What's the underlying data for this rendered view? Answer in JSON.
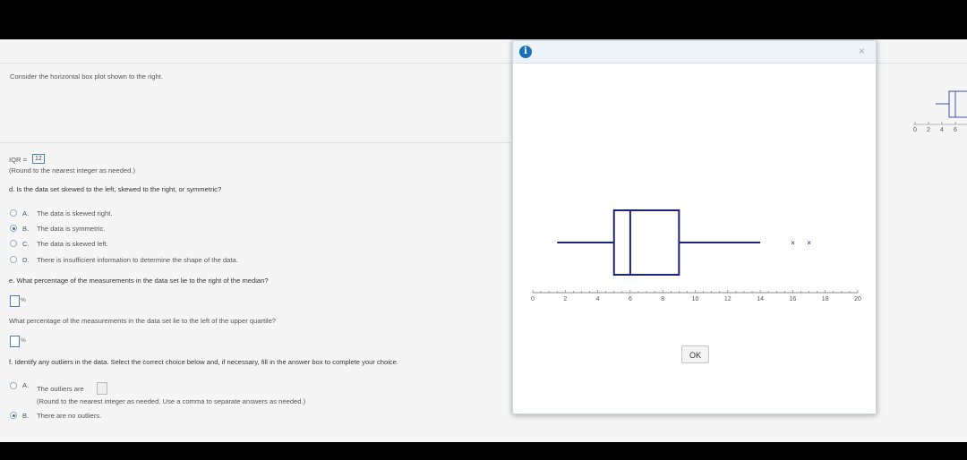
{
  "question": {
    "intro": "Consider the horizontal box plot shown to the right.",
    "iqr_label": "IQR =",
    "iqr_value": "12",
    "iqr_note": "(Round to the nearest integer as needed.)",
    "part_d": {
      "prompt": "d. Is the data set skewed to the left, skewed to the right, or symmetric?",
      "options": [
        {
          "letter": "A.",
          "text": "The data is skewed right.",
          "selected": false
        },
        {
          "letter": "B.",
          "text": "The data is symmetric.",
          "selected": true
        },
        {
          "letter": "C.",
          "text": "The data is skewed left.",
          "selected": false
        },
        {
          "letter": "D.",
          "text": "There is insufficient information to determine the shape of the data.",
          "selected": false
        }
      ]
    },
    "part_e": {
      "prompt1": "e. What percentage of the measurements in the data set lie to the right of the median?",
      "prompt2": "What percentage of the measurements in the data set lie to the left of the upper quartile?",
      "pct_symbol": "%"
    },
    "part_f": {
      "prompt": "f. Identify any outliers in the data. Select the correct choice below and, if necessary, fill in the answer box to complete your choice.",
      "option_a_letter": "A.",
      "option_a_text": "The outliers are",
      "option_a_note": "(Round to the nearest integer as needed. Use a comma to separate answers as needed.)",
      "option_b_letter": "B.",
      "option_b_text": "There are no outliers."
    }
  },
  "dialog": {
    "info_glyph": "i",
    "close_glyph": "×",
    "ok_label": "OK"
  },
  "chart_data": {
    "type": "boxplot",
    "orientation": "horizontal",
    "whisker_low": 1.5,
    "q1": 5,
    "median": 6,
    "q3": 9,
    "whisker_high": 14,
    "outliers": [
      16,
      17
    ],
    "xlim": [
      0,
      20
    ],
    "xticks": [
      0,
      2,
      4,
      6,
      8,
      10,
      12,
      14,
      16,
      18,
      20
    ],
    "color": "#1a237e"
  },
  "thumbnail": {
    "ticks": [
      "0",
      "2",
      "4",
      "6"
    ]
  }
}
